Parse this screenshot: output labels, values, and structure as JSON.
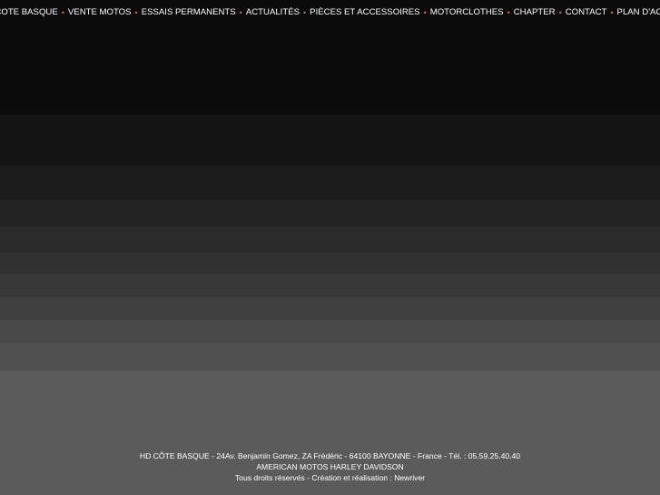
{
  "nav": {
    "items": [
      {
        "label": "HD COTE BASQUE"
      },
      {
        "label": "VENTE MOTOS"
      },
      {
        "label": "ESSAIS PERMANENTS"
      },
      {
        "label": "ACTUALITÉS"
      },
      {
        "label": "PIÈCES ET ACCESSOIRES"
      },
      {
        "label": "MOTORCLOTHES"
      },
      {
        "label": "CHAPTER"
      },
      {
        "label": "CONTACT"
      },
      {
        "label": "PLAN D'ACCES"
      }
    ],
    "separator": "•",
    "separator_color": "#e0631d"
  },
  "footer": {
    "address": "HD CÔTE BASQUE - 24Av. Benjamin Gomez, ZA Frédéric - 64100 BAYONNE - France - Tél. : 05.59.25.40.40",
    "brand": "AMERICAN MOTOS HARLEY DAVIDSON",
    "rights_prefix": "Tous droits réservés - Création et réalisation : ",
    "credit_link": "Newriver"
  },
  "colors": {
    "background_top": "#0b0b0b",
    "background_bottom": "#5b5b5b",
    "text": "#ffffff"
  }
}
